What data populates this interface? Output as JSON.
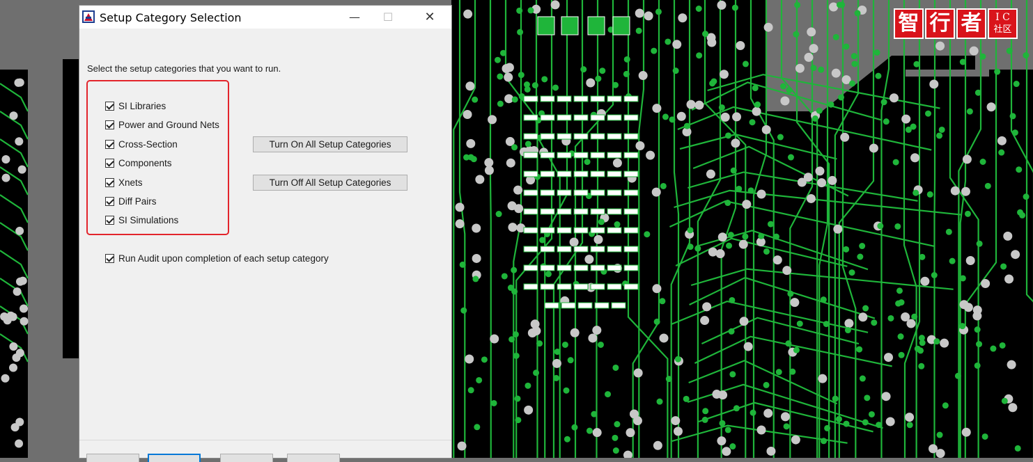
{
  "dialog": {
    "title": "Setup Category Selection",
    "minimize_glyph": "—",
    "maximize_glyph": "☐",
    "close_glyph": "✕",
    "instruction": "Select the setup categories that you want to run.",
    "categories": [
      {
        "label": "SI Libraries",
        "checked": true
      },
      {
        "label": "Power and Ground Nets",
        "checked": true
      },
      {
        "label": "Cross-Section",
        "checked": true
      },
      {
        "label": "Components",
        "checked": true
      },
      {
        "label": "Xnets",
        "checked": true
      },
      {
        "label": "Diff Pairs",
        "checked": true
      },
      {
        "label": "SI Simulations",
        "checked": true
      }
    ],
    "turn_on_all": "Turn On All Setup Categories",
    "turn_off_all": "Turn Off All Setup Categories",
    "run_audit": {
      "label": "Run Audit upon completion of each setup category",
      "checked": true
    },
    "highlight_color": "#e3242b"
  },
  "logo": {
    "chars": [
      "智",
      "行",
      "者"
    ],
    "ic_top": "I C",
    "ic_bottom": "社区",
    "color": "#d9141b"
  },
  "pcb": {
    "trace_color": "#1fb53a",
    "board_color": "#000000",
    "via_color": "#c8c8c8"
  }
}
